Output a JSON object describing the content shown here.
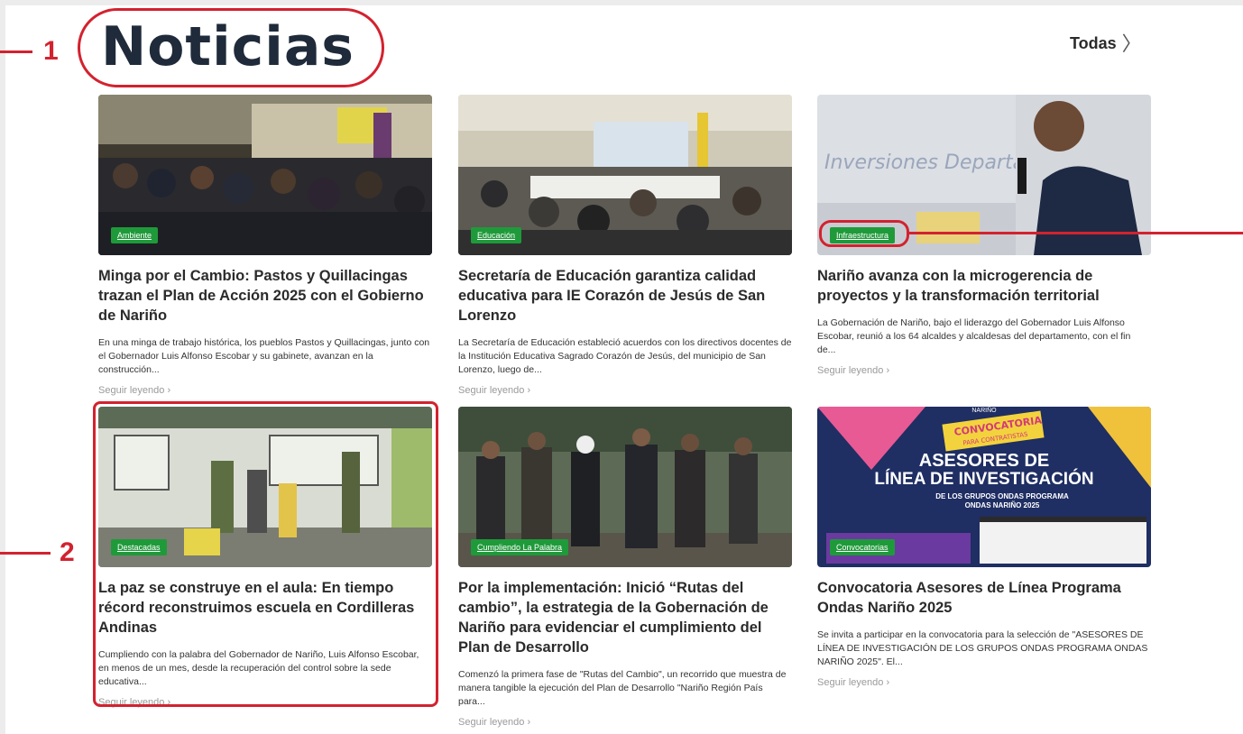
{
  "header": {
    "title": "Noticias",
    "all_label": "Todas",
    "all_chevron": "〉"
  },
  "annotations": {
    "one": "1",
    "two": "2"
  },
  "link_label": "Seguir leyendo ›",
  "cards": [
    {
      "category": "Ambiente",
      "title": "Minga por el Cambio: Pastos y Quillacingas trazan el Plan de Acción 2025 con el Gobierno de Nariño",
      "excerpt": "En una minga de trabajo histórica, los pueblos Pastos y Quillacingas, junto con el Gobernador Luis Alfonso Escobar y su gabinete, avanzan en la construcción...",
      "image": "minga-event-photo"
    },
    {
      "category": "Educación",
      "title": "Secretaría de Educación garantiza calidad educativa para IE Corazón de Jesús de San Lorenzo",
      "excerpt": "La Secretaría de Educación estableció acuerdos con los directivos docentes de la Institución Educativa Sagrado Corazón de Jesús, del municipio de San Lorenzo, luego de...",
      "image": "meeting-room-photo"
    },
    {
      "category": "Infraestructura",
      "title": "Nariño avanza con la microgerencia de proyectos y la transformación territorial",
      "excerpt": "La Gobernación de Nariño, bajo el liderazgo del Gobernador Luis Alfonso Escobar, reunió a los 64 alcaldes y alcaldesas del departamento, con el fin de...",
      "image": "speaker-photo",
      "image_text": "Inversiones Departamenta"
    },
    {
      "category": "Destacadas",
      "title": "La paz se construye en el aula: En tiempo récord reconstruimos escuela en Cordilleras Andinas",
      "excerpt": "Cumpliendo con la palabra del Gobernador de Nariño, Luis Alfonso Escobar, en menos de un mes, desde la recuperación del control sobre la sede educativa...",
      "image": "school-painting-photo"
    },
    {
      "category": "Cumpliendo La Palabra",
      "title": "Por la implementación: Inició “Rutas del cambio”, la estrategia de la Gobernación de Nariño para evidenciar el cumplimiento del Plan de Desarrollo",
      "excerpt": "Comenzó la primera fase de \"Rutas del Cambio\", un recorrido que muestra de manera tangible la ejecución del Plan de Desarrollo \"Nariño Región País para...",
      "image": "group-walking-photo"
    },
    {
      "category": "Convocatorias",
      "title": "Convocatoria Asesores de Línea Programa Ondas Nariño 2025",
      "excerpt": "Se invita a participar en la convocatoria para la selección de \"ASESORES DE LÍNEA DE INVESTIGACIÓN DE LOS GRUPOS ONDAS PROGRAMA ONDAS NARIÑO 2025\". El...",
      "image": "convocatoria-poster",
      "poster": {
        "tag1": "CONVOCATORIA",
        "tag2": "PARA CONTRATISTAS",
        "line1": "ASESORES DE",
        "line2": "LÍNEA DE INVESTIGACIÓN",
        "line3": "DE LOS GRUPOS ONDAS PROGRAMA",
        "line4": "ONDAS NARIÑO 2025",
        "top": "NARIÑO"
      }
    }
  ],
  "colors": {
    "badge": "#1f9a3a",
    "annotation": "#d3222f",
    "title": "#1f2a3a"
  }
}
